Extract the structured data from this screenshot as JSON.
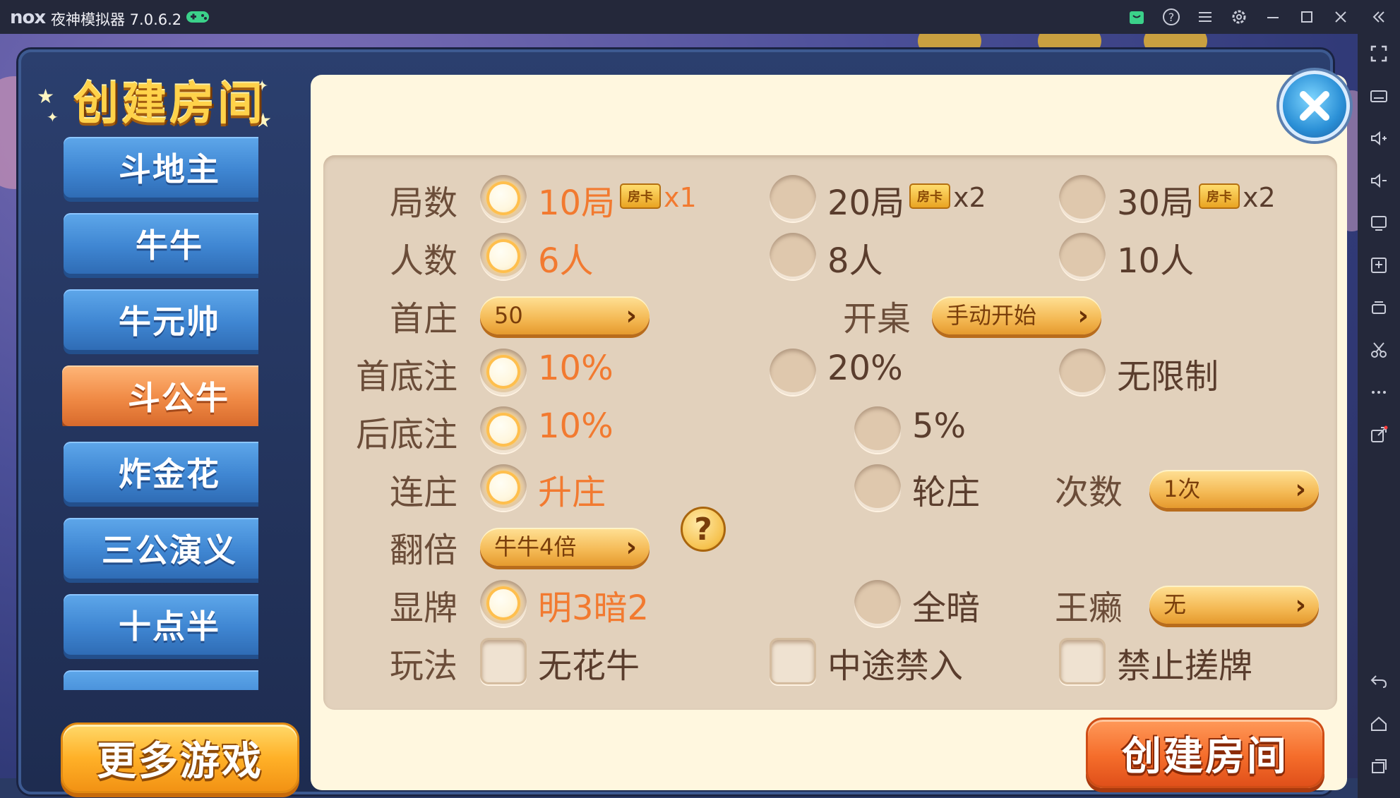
{
  "emulator": {
    "logo": "nox",
    "title": "夜神模拟器 7.0.6.2",
    "titlebar_icons": [
      "gamepad-icon",
      "store-icon",
      "help-icon",
      "menu-icon",
      "settings-icon",
      "minimize-icon",
      "maximize-icon",
      "close-icon",
      "collapse-icon"
    ],
    "sidebar_icons": [
      "fullscreen-icon",
      "keyboard-icon",
      "volume-up-icon",
      "volume-down-icon",
      "screen-icon",
      "apk-install-icon",
      "multi-instance-icon",
      "scissors-icon",
      "more-icon",
      "share-icon",
      "back-icon",
      "home-icon",
      "recent-apps-icon"
    ]
  },
  "dialog": {
    "title": "创建房间",
    "games": [
      {
        "label": "斗地主",
        "active": false
      },
      {
        "label": "牛牛",
        "active": false
      },
      {
        "label": "牛元帅",
        "active": false
      },
      {
        "label": "斗公牛",
        "active": true
      },
      {
        "label": "炸金花",
        "active": false
      },
      {
        "label": "三公演义",
        "active": false
      },
      {
        "label": "十点半",
        "active": false
      }
    ],
    "more_games": "更多游戏",
    "create_button": "创建房间"
  },
  "options": {
    "rounds": {
      "label": "局数",
      "choices": [
        {
          "text": "10局",
          "card": "房卡",
          "mult": "x1",
          "selected": true
        },
        {
          "text": "20局",
          "card": "房卡",
          "mult": "x2",
          "selected": false
        },
        {
          "text": "30局",
          "card": "房卡",
          "mult": "x2",
          "selected": false
        }
      ]
    },
    "players": {
      "label": "人数",
      "choices": [
        {
          "text": "6人",
          "selected": true
        },
        {
          "text": "8人",
          "selected": false
        },
        {
          "text": "10人",
          "selected": false
        }
      ]
    },
    "first_banker": {
      "label": "首庄",
      "value": "50"
    },
    "start_table": {
      "label": "开桌",
      "value": "手动开始"
    },
    "first_bet": {
      "label": "首底注",
      "choices": [
        {
          "text": "10%",
          "selected": true
        },
        {
          "text": "20%",
          "selected": false
        },
        {
          "text": "无限制",
          "selected": false
        }
      ]
    },
    "later_bet": {
      "label": "后底注",
      "choices": [
        {
          "text": "10%",
          "selected": true
        },
        {
          "text": "5%",
          "selected": false
        }
      ]
    },
    "banker_mode": {
      "label": "连庄",
      "choices": [
        {
          "text": "升庄",
          "selected": true
        },
        {
          "text": "轮庄",
          "selected": false
        }
      ]
    },
    "times": {
      "label": "次数",
      "value": "1次"
    },
    "double": {
      "label": "翻倍",
      "value": "牛牛4倍",
      "help": "?"
    },
    "show_cards": {
      "label": "显牌",
      "choices": [
        {
          "text": "明3暗2",
          "selected": true
        },
        {
          "text": "全暗",
          "selected": false
        }
      ]
    },
    "wild": {
      "label": "王癞",
      "value": "无"
    },
    "play": {
      "label": "玩法",
      "choices": [
        {
          "text": "无花牛",
          "checked": false
        },
        {
          "text": "中途禁入",
          "checked": false
        },
        {
          "text": "禁止搓牌",
          "checked": false
        }
      ]
    }
  },
  "colors": {
    "selected_text": "#f27a30",
    "normal_text": "#5a3d2d",
    "label_text": "#6b4d39",
    "panel_bg": "#fff7df",
    "option_bg": "#e2d1bc",
    "tab_blue": "#3f86d2",
    "tab_orange": "#f08a45"
  }
}
